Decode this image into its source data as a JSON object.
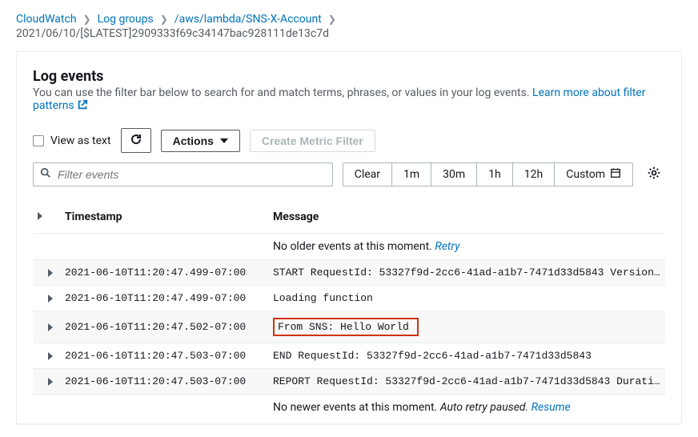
{
  "breadcrumb": {
    "items": [
      "CloudWatch",
      "Log groups",
      "/aws/lambda/SNS-X-Account"
    ],
    "current": "2021/06/10/[$LATEST]2909333f69c34147bac928111de13c7d"
  },
  "panel": {
    "title": "Log events",
    "subtitle_text": "You can use the filter bar below to search for and match terms, phrases, or values in your log events. ",
    "learn_more": "Learn more about filter patterns"
  },
  "toolbar": {
    "view_as_text": "View as text",
    "actions": "Actions",
    "create_metric_filter": "Create Metric Filter"
  },
  "filter": {
    "placeholder": "Filter events",
    "clear": "Clear",
    "ranges": [
      "1m",
      "30m",
      "1h",
      "12h"
    ],
    "custom": "Custom"
  },
  "table": {
    "headers": {
      "timestamp": "Timestamp",
      "message": "Message"
    },
    "older_msg": "No older events at this moment. ",
    "older_retry": "Retry",
    "newer_msg_a": "No newer events at this moment. ",
    "newer_msg_b": "Auto retry paused. ",
    "newer_resume": "Resume",
    "rows": [
      {
        "ts": "2021-06-10T11:20:47.499-07:00",
        "msg": "START RequestId: 53327f9d-2cc6-41ad-a1b7-7471d33d5843 Version:…",
        "highlight": false
      },
      {
        "ts": "2021-06-10T11:20:47.499-07:00",
        "msg": "Loading function",
        "highlight": false
      },
      {
        "ts": "2021-06-10T11:20:47.502-07:00",
        "msg": "From SNS: Hello World",
        "highlight": true
      },
      {
        "ts": "2021-06-10T11:20:47.503-07:00",
        "msg": "END RequestId: 53327f9d-2cc6-41ad-a1b7-7471d33d5843",
        "highlight": false
      },
      {
        "ts": "2021-06-10T11:20:47.503-07:00",
        "msg": "REPORT RequestId: 53327f9d-2cc6-41ad-a1b7-7471d33d5843 Duratio…",
        "highlight": false
      }
    ]
  }
}
